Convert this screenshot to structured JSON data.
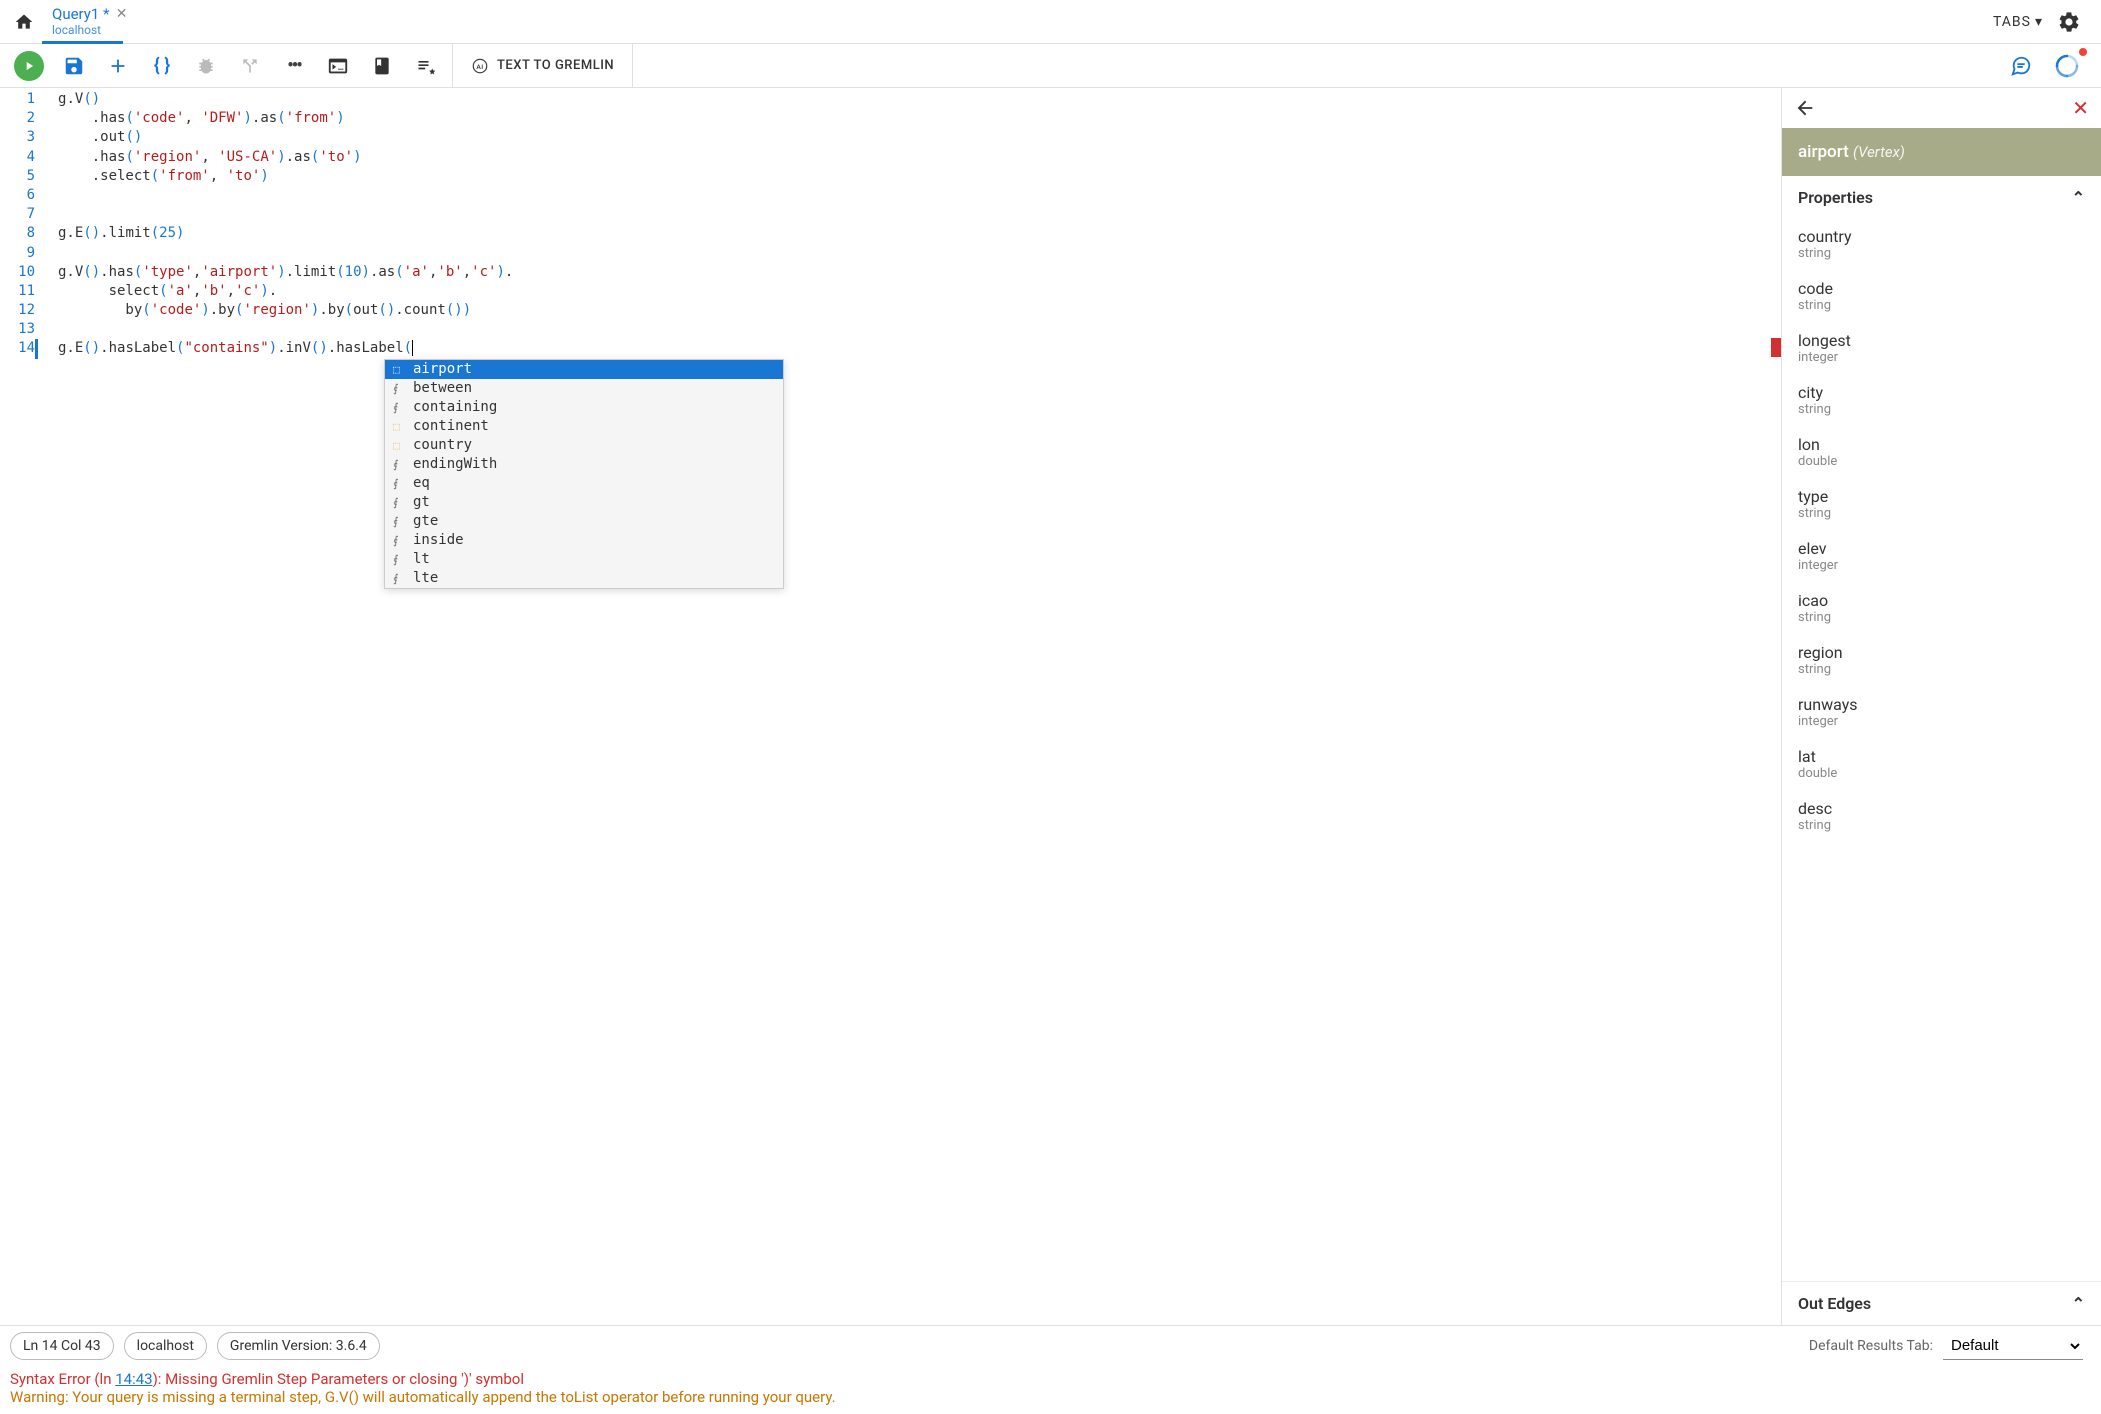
{
  "header": {
    "tab_title": "Query1 *",
    "tab_subtitle": "localhost",
    "tabs_menu_label": "TABS"
  },
  "toolbar": {
    "text_to_gremlin": "TEXT TO GREMLIN"
  },
  "editor": {
    "lines": [
      {
        "n": 1,
        "tokens": [
          {
            "t": "g",
            "c": ""
          },
          {
            "t": ".",
            "c": "dot"
          },
          {
            "t": "V",
            "c": ""
          },
          {
            "t": "()",
            "c": "paren"
          }
        ]
      },
      {
        "n": 2,
        "tokens": [
          {
            "t": "    .has",
            "c": ""
          },
          {
            "t": "(",
            "c": "paren"
          },
          {
            "t": "'code'",
            "c": "str"
          },
          {
            "t": ", ",
            "c": ""
          },
          {
            "t": "'DFW'",
            "c": "str"
          },
          {
            "t": ")",
            "c": "paren"
          },
          {
            "t": ".as",
            "c": ""
          },
          {
            "t": "(",
            "c": "paren"
          },
          {
            "t": "'from'",
            "c": "str"
          },
          {
            "t": ")",
            "c": "paren"
          }
        ]
      },
      {
        "n": 3,
        "tokens": [
          {
            "t": "    .out",
            "c": ""
          },
          {
            "t": "()",
            "c": "paren"
          }
        ]
      },
      {
        "n": 4,
        "tokens": [
          {
            "t": "    .has",
            "c": ""
          },
          {
            "t": "(",
            "c": "paren"
          },
          {
            "t": "'region'",
            "c": "str"
          },
          {
            "t": ", ",
            "c": ""
          },
          {
            "t": "'US-CA'",
            "c": "str"
          },
          {
            "t": ")",
            "c": "paren"
          },
          {
            "t": ".as",
            "c": ""
          },
          {
            "t": "(",
            "c": "paren"
          },
          {
            "t": "'to'",
            "c": "str"
          },
          {
            "t": ")",
            "c": "paren"
          }
        ]
      },
      {
        "n": 5,
        "tokens": [
          {
            "t": "    .select",
            "c": ""
          },
          {
            "t": "(",
            "c": "paren"
          },
          {
            "t": "'from'",
            "c": "str"
          },
          {
            "t": ", ",
            "c": ""
          },
          {
            "t": "'to'",
            "c": "str"
          },
          {
            "t": ")",
            "c": "paren"
          }
        ]
      },
      {
        "n": 6,
        "tokens": []
      },
      {
        "n": 7,
        "tokens": []
      },
      {
        "n": 8,
        "tokens": [
          {
            "t": "g.E",
            "c": ""
          },
          {
            "t": "()",
            "c": "paren"
          },
          {
            "t": ".limit",
            "c": ""
          },
          {
            "t": "(",
            "c": "paren"
          },
          {
            "t": "25",
            "c": "num"
          },
          {
            "t": ")",
            "c": "paren"
          }
        ]
      },
      {
        "n": 9,
        "tokens": []
      },
      {
        "n": 10,
        "tokens": [
          {
            "t": "g.V",
            "c": ""
          },
          {
            "t": "()",
            "c": "paren"
          },
          {
            "t": ".has",
            "c": ""
          },
          {
            "t": "(",
            "c": "paren"
          },
          {
            "t": "'type'",
            "c": "str"
          },
          {
            "t": ",",
            "c": ""
          },
          {
            "t": "'airport'",
            "c": "str"
          },
          {
            "t": ")",
            "c": "paren"
          },
          {
            "t": ".limit",
            "c": ""
          },
          {
            "t": "(",
            "c": "paren"
          },
          {
            "t": "10",
            "c": "num"
          },
          {
            "t": ")",
            "c": "paren"
          },
          {
            "t": ".as",
            "c": ""
          },
          {
            "t": "(",
            "c": "paren"
          },
          {
            "t": "'a'",
            "c": "str"
          },
          {
            "t": ",",
            "c": ""
          },
          {
            "t": "'b'",
            "c": "str"
          },
          {
            "t": ",",
            "c": ""
          },
          {
            "t": "'c'",
            "c": "str"
          },
          {
            "t": ")",
            "c": "paren"
          },
          {
            "t": ".",
            "c": ""
          }
        ]
      },
      {
        "n": 11,
        "tokens": [
          {
            "t": "      select",
            "c": ""
          },
          {
            "t": "(",
            "c": "paren"
          },
          {
            "t": "'a'",
            "c": "str"
          },
          {
            "t": ",",
            "c": ""
          },
          {
            "t": "'b'",
            "c": "str"
          },
          {
            "t": ",",
            "c": ""
          },
          {
            "t": "'c'",
            "c": "str"
          },
          {
            "t": ")",
            "c": "paren"
          },
          {
            "t": ".",
            "c": ""
          }
        ]
      },
      {
        "n": 12,
        "tokens": [
          {
            "t": "        by",
            "c": ""
          },
          {
            "t": "(",
            "c": "paren"
          },
          {
            "t": "'code'",
            "c": "str"
          },
          {
            "t": ")",
            "c": "paren"
          },
          {
            "t": ".by",
            "c": ""
          },
          {
            "t": "(",
            "c": "paren"
          },
          {
            "t": "'region'",
            "c": "str"
          },
          {
            "t": ")",
            "c": "paren"
          },
          {
            "t": ".by",
            "c": ""
          },
          {
            "t": "(",
            "c": "paren"
          },
          {
            "t": "out",
            "c": ""
          },
          {
            "t": "()",
            "c": "paren"
          },
          {
            "t": ".count",
            "c": ""
          },
          {
            "t": "()",
            "c": "paren"
          },
          {
            "t": ")",
            "c": "paren"
          }
        ]
      },
      {
        "n": 13,
        "tokens": []
      },
      {
        "n": 14,
        "tokens": [
          {
            "t": "g.E",
            "c": ""
          },
          {
            "t": "()",
            "c": "paren"
          },
          {
            "t": ".hasLabel",
            "c": ""
          },
          {
            "t": "(",
            "c": "paren"
          },
          {
            "t": "\"contains\"",
            "c": "str"
          },
          {
            "t": ")",
            "c": "paren"
          },
          {
            "t": ".inV",
            "c": ""
          },
          {
            "t": "()",
            "c": "paren"
          },
          {
            "t": ".hasLabel",
            "c": ""
          },
          {
            "t": "(",
            "c": "paren"
          }
        ]
      }
    ],
    "current_line": 14,
    "autocomplete": {
      "selected_index": 0,
      "items": [
        {
          "label": "airport",
          "kind": "label"
        },
        {
          "label": "between",
          "kind": "func"
        },
        {
          "label": "containing",
          "kind": "func"
        },
        {
          "label": "continent",
          "kind": "label"
        },
        {
          "label": "country",
          "kind": "label"
        },
        {
          "label": "endingWith",
          "kind": "func"
        },
        {
          "label": "eq",
          "kind": "func"
        },
        {
          "label": "gt",
          "kind": "func"
        },
        {
          "label": "gte",
          "kind": "func"
        },
        {
          "label": "inside",
          "kind": "func"
        },
        {
          "label": "lt",
          "kind": "func"
        },
        {
          "label": "lte",
          "kind": "func"
        }
      ]
    }
  },
  "side_panel": {
    "title_label": "airport",
    "title_kind": "(Vertex)",
    "section_properties": "Properties",
    "section_out_edges": "Out Edges",
    "properties": [
      {
        "name": "country",
        "type": "string"
      },
      {
        "name": "code",
        "type": "string"
      },
      {
        "name": "longest",
        "type": "integer"
      },
      {
        "name": "city",
        "type": "string"
      },
      {
        "name": "lon",
        "type": "double"
      },
      {
        "name": "type",
        "type": "string"
      },
      {
        "name": "elev",
        "type": "integer"
      },
      {
        "name": "icao",
        "type": "string"
      },
      {
        "name": "region",
        "type": "string"
      },
      {
        "name": "runways",
        "type": "integer"
      },
      {
        "name": "lat",
        "type": "double"
      },
      {
        "name": "desc",
        "type": "string"
      }
    ]
  },
  "status": {
    "position": "Ln 14 Col 43",
    "connection": "localhost",
    "version": "Gremlin Version: 3.6.4",
    "default_results_label": "Default Results Tab:",
    "default_results_value": "Default"
  },
  "messages": {
    "error_prefix": "Syntax Error (ln ",
    "error_link": "14:43",
    "error_suffix": "): Missing Gremlin Step Parameters or closing ')' symbol",
    "warning": "Warning: Your query is missing a terminal step, G.V() will automatically append the toList operator before running your query."
  }
}
